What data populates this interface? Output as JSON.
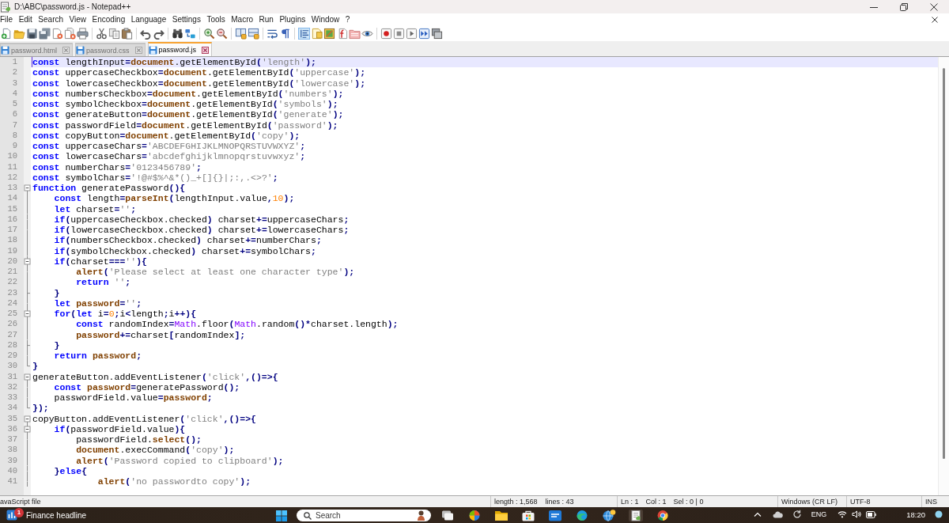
{
  "window": {
    "title": "D:\\ABC\\password.js - Notepad++"
  },
  "menu": [
    "File",
    "Edit",
    "Search",
    "View",
    "Encoding",
    "Language",
    "Settings",
    "Tools",
    "Macro",
    "Run",
    "Plugins",
    "Window",
    "?"
  ],
  "toolbar": {
    "groups": [
      {
        "buttons": [
          {
            "kind": "new",
            "pressed": false
          },
          {
            "kind": "open",
            "pressed": false
          },
          {
            "kind": "save",
            "pressed": false
          },
          {
            "kind": "save-all",
            "pressed": false
          },
          {
            "kind": "close",
            "pressed": false
          },
          {
            "kind": "close-all",
            "pressed": false
          },
          {
            "kind": "print",
            "pressed": false
          }
        ]
      },
      {
        "buttons": [
          {
            "kind": "cut",
            "pressed": false
          },
          {
            "kind": "copy",
            "pressed": false
          },
          {
            "kind": "paste",
            "pressed": false
          }
        ]
      },
      {
        "buttons": [
          {
            "kind": "undo",
            "pressed": false
          },
          {
            "kind": "redo",
            "pressed": false
          }
        ]
      },
      {
        "buttons": [
          {
            "kind": "find",
            "pressed": false
          },
          {
            "kind": "replace",
            "pressed": false
          }
        ]
      },
      {
        "buttons": [
          {
            "kind": "zoom-in",
            "pressed": false
          },
          {
            "kind": "zoom-out",
            "pressed": false
          }
        ]
      },
      {
        "buttons": [
          {
            "kind": "sync-vertical",
            "pressed": false
          },
          {
            "kind": "sync-horizontal",
            "pressed": false
          }
        ]
      },
      {
        "buttons": [
          {
            "kind": "wrap",
            "pressed": false
          },
          {
            "kind": "show-all",
            "pressed": false
          }
        ]
      },
      {
        "buttons": [
          {
            "kind": "indent-guide",
            "pressed": true
          },
          {
            "kind": "doc-map",
            "pressed": false
          },
          {
            "kind": "function-list",
            "pressed": false
          },
          {
            "kind": "doc-list",
            "pressed": false
          },
          {
            "kind": "workspace",
            "pressed": false
          },
          {
            "kind": "monitor",
            "pressed": false
          }
        ]
      },
      {
        "buttons": [
          {
            "kind": "record",
            "pressed": false
          },
          {
            "kind": "stop",
            "pressed": false
          },
          {
            "kind": "play",
            "pressed": false
          },
          {
            "kind": "play-multiple",
            "pressed": false
          },
          {
            "kind": "save-macro",
            "pressed": false
          }
        ]
      }
    ]
  },
  "tabs": [
    {
      "label": "password.html",
      "selected": false
    },
    {
      "label": "password.css",
      "selected": false
    },
    {
      "label": "password.js",
      "selected": true
    }
  ],
  "editor": {
    "lines": [
      {
        "number": "1",
        "kind": "plain",
        "current": true,
        "tokens": [
          {
            "kind": "kw",
            "text": "const"
          },
          {
            "kind": "txt",
            "text": " lengthInput"
          },
          {
            "kind": "op",
            "text": "="
          },
          {
            "kind": "obj",
            "text": "document"
          },
          {
            "kind": "txt",
            "text": ".getElementById"
          },
          {
            "kind": "op",
            "text": "("
          },
          {
            "kind": "str",
            "text": "'length'"
          },
          {
            "kind": "op",
            "text": ");"
          }
        ]
      },
      {
        "number": "2",
        "kind": "plain",
        "current": false,
        "tokens": [
          {
            "kind": "kw",
            "text": "const"
          },
          {
            "kind": "txt",
            "text": " uppercaseCheckbox"
          },
          {
            "kind": "op",
            "text": "="
          },
          {
            "kind": "obj",
            "text": "document"
          },
          {
            "kind": "txt",
            "text": ".getElementById"
          },
          {
            "kind": "op",
            "text": "("
          },
          {
            "kind": "str",
            "text": "'uppercase'"
          },
          {
            "kind": "op",
            "text": ");"
          }
        ]
      },
      {
        "number": "3",
        "kind": "plain",
        "current": false,
        "tokens": [
          {
            "kind": "kw",
            "text": "const"
          },
          {
            "kind": "txt",
            "text": " lowercaseCheckbox"
          },
          {
            "kind": "op",
            "text": "="
          },
          {
            "kind": "obj",
            "text": "document"
          },
          {
            "kind": "txt",
            "text": ".getElementById"
          },
          {
            "kind": "op",
            "text": "("
          },
          {
            "kind": "str",
            "text": "'lowercase'"
          },
          {
            "kind": "op",
            "text": ");"
          }
        ]
      },
      {
        "number": "4",
        "kind": "plain",
        "current": false,
        "tokens": [
          {
            "kind": "kw",
            "text": "const"
          },
          {
            "kind": "txt",
            "text": " numbersCheckbox"
          },
          {
            "kind": "op",
            "text": "="
          },
          {
            "kind": "obj",
            "text": "document"
          },
          {
            "kind": "txt",
            "text": ".getElementById"
          },
          {
            "kind": "op",
            "text": "("
          },
          {
            "kind": "str",
            "text": "'numbers'"
          },
          {
            "kind": "op",
            "text": ");"
          }
        ]
      },
      {
        "number": "5",
        "kind": "plain",
        "current": false,
        "tokens": [
          {
            "kind": "kw",
            "text": "const"
          },
          {
            "kind": "txt",
            "text": " symbolCheckbox"
          },
          {
            "kind": "op",
            "text": "="
          },
          {
            "kind": "obj",
            "text": "document"
          },
          {
            "kind": "txt",
            "text": ".getElementById"
          },
          {
            "kind": "op",
            "text": "("
          },
          {
            "kind": "str",
            "text": "'symbols'"
          },
          {
            "kind": "op",
            "text": ");"
          }
        ]
      },
      {
        "number": "6",
        "kind": "plain",
        "current": false,
        "tokens": [
          {
            "kind": "kw",
            "text": "const"
          },
          {
            "kind": "txt",
            "text": " generateButton"
          },
          {
            "kind": "op",
            "text": "="
          },
          {
            "kind": "obj",
            "text": "document"
          },
          {
            "kind": "txt",
            "text": ".getElementById"
          },
          {
            "kind": "op",
            "text": "("
          },
          {
            "kind": "str",
            "text": "'generate'"
          },
          {
            "kind": "op",
            "text": ");"
          }
        ]
      },
      {
        "number": "7",
        "kind": "plain",
        "current": false,
        "tokens": [
          {
            "kind": "kw",
            "text": "const"
          },
          {
            "kind": "txt",
            "text": " passwordField"
          },
          {
            "kind": "op",
            "text": "="
          },
          {
            "kind": "obj",
            "text": "document"
          },
          {
            "kind": "txt",
            "text": ".getElementById"
          },
          {
            "kind": "op",
            "text": "("
          },
          {
            "kind": "str",
            "text": "'password'"
          },
          {
            "kind": "op",
            "text": ");"
          }
        ]
      },
      {
        "number": "8",
        "kind": "plain",
        "current": false,
        "tokens": [
          {
            "kind": "kw",
            "text": "const"
          },
          {
            "kind": "txt",
            "text": " copyButton"
          },
          {
            "kind": "op",
            "text": "="
          },
          {
            "kind": "obj",
            "text": "document"
          },
          {
            "kind": "txt",
            "text": ".getElementById"
          },
          {
            "kind": "op",
            "text": "("
          },
          {
            "kind": "str",
            "text": "'copy'"
          },
          {
            "kind": "op",
            "text": ");"
          }
        ]
      },
      {
        "number": "9",
        "kind": "plain",
        "current": false,
        "tokens": [
          {
            "kind": "kw",
            "text": "const"
          },
          {
            "kind": "txt",
            "text": " uppercaseChars"
          },
          {
            "kind": "op",
            "text": "="
          },
          {
            "kind": "str",
            "text": "'ABCDEFGHIJKLMNOPQRSTUVWXYZ'"
          },
          {
            "kind": "op",
            "text": ";"
          }
        ]
      },
      {
        "number": "10",
        "kind": "plain",
        "current": false,
        "tokens": [
          {
            "kind": "kw",
            "text": "const"
          },
          {
            "kind": "txt",
            "text": " lowercaseChars"
          },
          {
            "kind": "op",
            "text": "="
          },
          {
            "kind": "str",
            "text": "'abcdefghijklmnopqrstuvwxyz'"
          },
          {
            "kind": "op",
            "text": ";"
          }
        ]
      },
      {
        "number": "11",
        "kind": "plain",
        "current": false,
        "tokens": [
          {
            "kind": "kw",
            "text": "const"
          },
          {
            "kind": "txt",
            "text": " numberChars"
          },
          {
            "kind": "op",
            "text": "="
          },
          {
            "kind": "str",
            "text": "'0123456789'"
          },
          {
            "kind": "op",
            "text": ";"
          }
        ]
      },
      {
        "number": "12",
        "kind": "plain",
        "current": false,
        "tokens": [
          {
            "kind": "kw",
            "text": "const"
          },
          {
            "kind": "txt",
            "text": " symbolChars"
          },
          {
            "kind": "op",
            "text": "="
          },
          {
            "kind": "str",
            "text": "'!@#$%^&*()_+[]{}|;:,.<>?'"
          },
          {
            "kind": "op",
            "text": ";"
          }
        ]
      },
      {
        "number": "13",
        "kind": "opener",
        "current": false,
        "tokens": [
          {
            "kind": "kw",
            "text": "function"
          },
          {
            "kind": "txt",
            "text": " generatePassword"
          },
          {
            "kind": "op",
            "text": "(){"
          }
        ]
      },
      {
        "number": "14",
        "kind": "plain",
        "current": false,
        "tokens": [
          {
            "kind": "kw",
            "text": "    const"
          },
          {
            "kind": "txt",
            "text": " length"
          },
          {
            "kind": "op",
            "text": "="
          },
          {
            "kind": "obj",
            "text": "parseInt"
          },
          {
            "kind": "op",
            "text": "("
          },
          {
            "kind": "txt",
            "text": "lengthInput.value"
          },
          {
            "kind": "op",
            "text": ","
          },
          {
            "kind": "num",
            "text": "10"
          },
          {
            "kind": "op",
            "text": ");"
          }
        ]
      },
      {
        "number": "15",
        "kind": "plain",
        "current": false,
        "tokens": [
          {
            "kind": "kw",
            "text": "    let"
          },
          {
            "kind": "txt",
            "text": " charset"
          },
          {
            "kind": "op",
            "text": "="
          },
          {
            "kind": "str",
            "text": "''"
          },
          {
            "kind": "op",
            "text": ";"
          }
        ]
      },
      {
        "number": "16",
        "kind": "plain",
        "current": false,
        "tokens": [
          {
            "kind": "kw",
            "text": "    if"
          },
          {
            "kind": "op",
            "text": "("
          },
          {
            "kind": "txt",
            "text": "uppercaseCheckbox.checked"
          },
          {
            "kind": "op",
            "text": ")"
          },
          {
            "kind": "txt",
            "text": " charset"
          },
          {
            "kind": "op",
            "text": "+="
          },
          {
            "kind": "txt",
            "text": "uppercaseChars"
          },
          {
            "kind": "op",
            "text": ";"
          }
        ]
      },
      {
        "number": "17",
        "kind": "plain",
        "current": false,
        "tokens": [
          {
            "kind": "kw",
            "text": "    if"
          },
          {
            "kind": "op",
            "text": "("
          },
          {
            "kind": "txt",
            "text": "lowercaseCheckbox.checked"
          },
          {
            "kind": "op",
            "text": ")"
          },
          {
            "kind": "txt",
            "text": " charset"
          },
          {
            "kind": "op",
            "text": "+="
          },
          {
            "kind": "txt",
            "text": "lowercaseChars"
          },
          {
            "kind": "op",
            "text": ";"
          }
        ]
      },
      {
        "number": "18",
        "kind": "plain",
        "current": false,
        "tokens": [
          {
            "kind": "kw",
            "text": "    if"
          },
          {
            "kind": "op",
            "text": "("
          },
          {
            "kind": "txt",
            "text": "numbersCheckbox.checked"
          },
          {
            "kind": "op",
            "text": ")"
          },
          {
            "kind": "txt",
            "text": " charset"
          },
          {
            "kind": "op",
            "text": "+="
          },
          {
            "kind": "txt",
            "text": "numberChars"
          },
          {
            "kind": "op",
            "text": ";"
          }
        ]
      },
      {
        "number": "19",
        "kind": "plain",
        "current": false,
        "tokens": [
          {
            "kind": "kw",
            "text": "    if"
          },
          {
            "kind": "op",
            "text": "("
          },
          {
            "kind": "txt",
            "text": "symbolCheckbox.checked"
          },
          {
            "kind": "op",
            "text": ")"
          },
          {
            "kind": "txt",
            "text": " charset"
          },
          {
            "kind": "op",
            "text": "+="
          },
          {
            "kind": "txt",
            "text": "symbolChars"
          },
          {
            "kind": "op",
            "text": ";"
          }
        ]
      },
      {
        "number": "20",
        "kind": "opener",
        "current": false,
        "tokens": [
          {
            "kind": "kw",
            "text": "    if"
          },
          {
            "kind": "op",
            "text": "("
          },
          {
            "kind": "txt",
            "text": "charset"
          },
          {
            "kind": "op",
            "text": "==="
          },
          {
            "kind": "str",
            "text": "''"
          },
          {
            "kind": "op",
            "text": "){"
          }
        ]
      },
      {
        "number": "21",
        "kind": "plain",
        "current": false,
        "tokens": [
          {
            "kind": "obj",
            "text": "        alert"
          },
          {
            "kind": "op",
            "text": "("
          },
          {
            "kind": "str",
            "text": "'Please select at least one character type'"
          },
          {
            "kind": "op",
            "text": ");"
          }
        ]
      },
      {
        "number": "22",
        "kind": "plain",
        "current": false,
        "tokens": [
          {
            "kind": "kw",
            "text": "        return "
          },
          {
            "kind": "str",
            "text": "''"
          },
          {
            "kind": "op",
            "text": ";"
          }
        ]
      },
      {
        "number": "23",
        "kind": "closer",
        "current": false,
        "tokens": [
          {
            "kind": "op",
            "text": "    }"
          }
        ]
      },
      {
        "number": "24",
        "kind": "plain",
        "current": false,
        "tokens": [
          {
            "kind": "kw",
            "text": "    let "
          },
          {
            "kind": "obj",
            "text": "password"
          },
          {
            "kind": "op",
            "text": "="
          },
          {
            "kind": "str",
            "text": "''"
          },
          {
            "kind": "op",
            "text": ";"
          }
        ]
      },
      {
        "number": "25",
        "kind": "opener",
        "current": false,
        "tokens": [
          {
            "kind": "kw",
            "text": "    for"
          },
          {
            "kind": "op",
            "text": "("
          },
          {
            "kind": "kw",
            "text": "let"
          },
          {
            "kind": "txt",
            "text": " i"
          },
          {
            "kind": "op",
            "text": "="
          },
          {
            "kind": "num",
            "text": "0"
          },
          {
            "kind": "op",
            "text": ";"
          },
          {
            "kind": "txt",
            "text": "i"
          },
          {
            "kind": "op",
            "text": "<"
          },
          {
            "kind": "txt",
            "text": "length"
          },
          {
            "kind": "op",
            "text": ";"
          },
          {
            "kind": "txt",
            "text": "i"
          },
          {
            "kind": "op",
            "text": "++){"
          }
        ]
      },
      {
        "number": "26",
        "kind": "plain",
        "current": false,
        "tokens": [
          {
            "kind": "kw",
            "text": "        const"
          },
          {
            "kind": "txt",
            "text": " randomIndex"
          },
          {
            "kind": "op",
            "text": "="
          },
          {
            "kind": "cls",
            "text": "Math"
          },
          {
            "kind": "txt",
            "text": ".floor"
          },
          {
            "kind": "op",
            "text": "("
          },
          {
            "kind": "cls",
            "text": "Math"
          },
          {
            "kind": "txt",
            "text": ".random"
          },
          {
            "kind": "op",
            "text": "()*"
          },
          {
            "kind": "txt",
            "text": "charset.length"
          },
          {
            "kind": "op",
            "text": ");"
          }
        ]
      },
      {
        "number": "27",
        "kind": "plain",
        "current": false,
        "tokens": [
          {
            "kind": "obj",
            "text": "        password"
          },
          {
            "kind": "op",
            "text": "+="
          },
          {
            "kind": "txt",
            "text": "charset"
          },
          {
            "kind": "op",
            "text": "["
          },
          {
            "kind": "txt",
            "text": "randomIndex"
          },
          {
            "kind": "op",
            "text": "];"
          }
        ]
      },
      {
        "number": "28",
        "kind": "closer",
        "current": false,
        "tokens": [
          {
            "kind": "op",
            "text": "    }"
          }
        ]
      },
      {
        "number": "29",
        "kind": "plain",
        "current": false,
        "tokens": [
          {
            "kind": "kw",
            "text": "    return "
          },
          {
            "kind": "obj",
            "text": "password"
          },
          {
            "kind": "op",
            "text": ";"
          }
        ]
      },
      {
        "number": "30",
        "kind": "closer",
        "current": false,
        "tokens": [
          {
            "kind": "op",
            "text": "}"
          }
        ]
      },
      {
        "number": "31",
        "kind": "opener",
        "current": false,
        "tokens": [
          {
            "kind": "txt",
            "text": "generateButton.addEventListener"
          },
          {
            "kind": "op",
            "text": "("
          },
          {
            "kind": "str",
            "text": "'click'"
          },
          {
            "kind": "op",
            "text": ",()=>{"
          }
        ]
      },
      {
        "number": "32",
        "kind": "plain",
        "current": false,
        "tokens": [
          {
            "kind": "kw",
            "text": "    const "
          },
          {
            "kind": "obj",
            "text": "password"
          },
          {
            "kind": "op",
            "text": "="
          },
          {
            "kind": "txt",
            "text": "generatePassword"
          },
          {
            "kind": "op",
            "text": "();"
          }
        ]
      },
      {
        "number": "33",
        "kind": "plain",
        "current": false,
        "tokens": [
          {
            "kind": "txt",
            "text": "    passwordField.value"
          },
          {
            "kind": "op",
            "text": "="
          },
          {
            "kind": "obj",
            "text": "password"
          },
          {
            "kind": "op",
            "text": ";"
          }
        ]
      },
      {
        "number": "34",
        "kind": "closer",
        "current": false,
        "tokens": [
          {
            "kind": "op",
            "text": "});"
          }
        ]
      },
      {
        "number": "35",
        "kind": "opener",
        "current": false,
        "tokens": [
          {
            "kind": "txt",
            "text": "copyButton.addEventListener"
          },
          {
            "kind": "op",
            "text": "("
          },
          {
            "kind": "str",
            "text": "'click'"
          },
          {
            "kind": "op",
            "text": ",()=>{"
          }
        ]
      },
      {
        "number": "36",
        "kind": "opener",
        "current": false,
        "tokens": [
          {
            "kind": "kw",
            "text": "    if"
          },
          {
            "kind": "op",
            "text": "("
          },
          {
            "kind": "txt",
            "text": "passwordField.value"
          },
          {
            "kind": "op",
            "text": "){"
          }
        ]
      },
      {
        "number": "37",
        "kind": "plain",
        "current": false,
        "tokens": [
          {
            "kind": "txt",
            "text": "        passwordField."
          },
          {
            "kind": "obj",
            "text": "select"
          },
          {
            "kind": "op",
            "text": "();"
          }
        ]
      },
      {
        "number": "38",
        "kind": "plain",
        "current": false,
        "tokens": [
          {
            "kind": "obj",
            "text": "        document"
          },
          {
            "kind": "txt",
            "text": ".execCommand"
          },
          {
            "kind": "op",
            "text": "("
          },
          {
            "kind": "str",
            "text": "'copy'"
          },
          {
            "kind": "op",
            "text": ");"
          }
        ]
      },
      {
        "number": "39",
        "kind": "plain",
        "current": false,
        "tokens": [
          {
            "kind": "obj",
            "text": "        alert"
          },
          {
            "kind": "op",
            "text": "("
          },
          {
            "kind": "str",
            "text": "'Password copied to clipboard'"
          },
          {
            "kind": "op",
            "text": ");"
          }
        ]
      },
      {
        "number": "40",
        "kind": "plain",
        "current": false,
        "tokens": [
          {
            "kind": "op",
            "text": "    }"
          },
          {
            "kind": "kw",
            "text": "else"
          },
          {
            "kind": "op",
            "text": "{"
          }
        ]
      },
      {
        "number": "41",
        "kind": "plain",
        "current": false,
        "tokens": [
          {
            "kind": "obj",
            "text": "            alert"
          },
          {
            "kind": "op",
            "text": "("
          },
          {
            "kind": "str",
            "text": "'no passwordto copy'"
          },
          {
            "kind": "op",
            "text": ");"
          }
        ]
      }
    ]
  },
  "status_bar": {
    "file_type": "avaScript file",
    "length": "length : 1,568",
    "lines": "lines : 43",
    "line": "Ln : 1",
    "column": "Col : 1",
    "selection": "Sel : 0 | 0",
    "eol": "Windows (CR LF)",
    "encoding": "UTF-8",
    "mode": "INS"
  },
  "taskbar": {
    "news": {
      "badge": "1",
      "headline": "Finance headline"
    },
    "search": {
      "placeholder": "Search"
    },
    "apps": [
      {
        "kind": "task-view",
        "active": false
      },
      {
        "kind": "swirl",
        "active": false
      },
      {
        "kind": "folder",
        "active": false
      },
      {
        "kind": "store",
        "active": false
      },
      {
        "kind": "tile",
        "active": false
      },
      {
        "kind": "wave",
        "active": false
      },
      {
        "kind": "globe",
        "active": false
      },
      {
        "kind": "notepad",
        "active": true
      },
      {
        "kind": "ring",
        "active": false
      }
    ],
    "language": "ENG",
    "time": "18:20"
  }
}
